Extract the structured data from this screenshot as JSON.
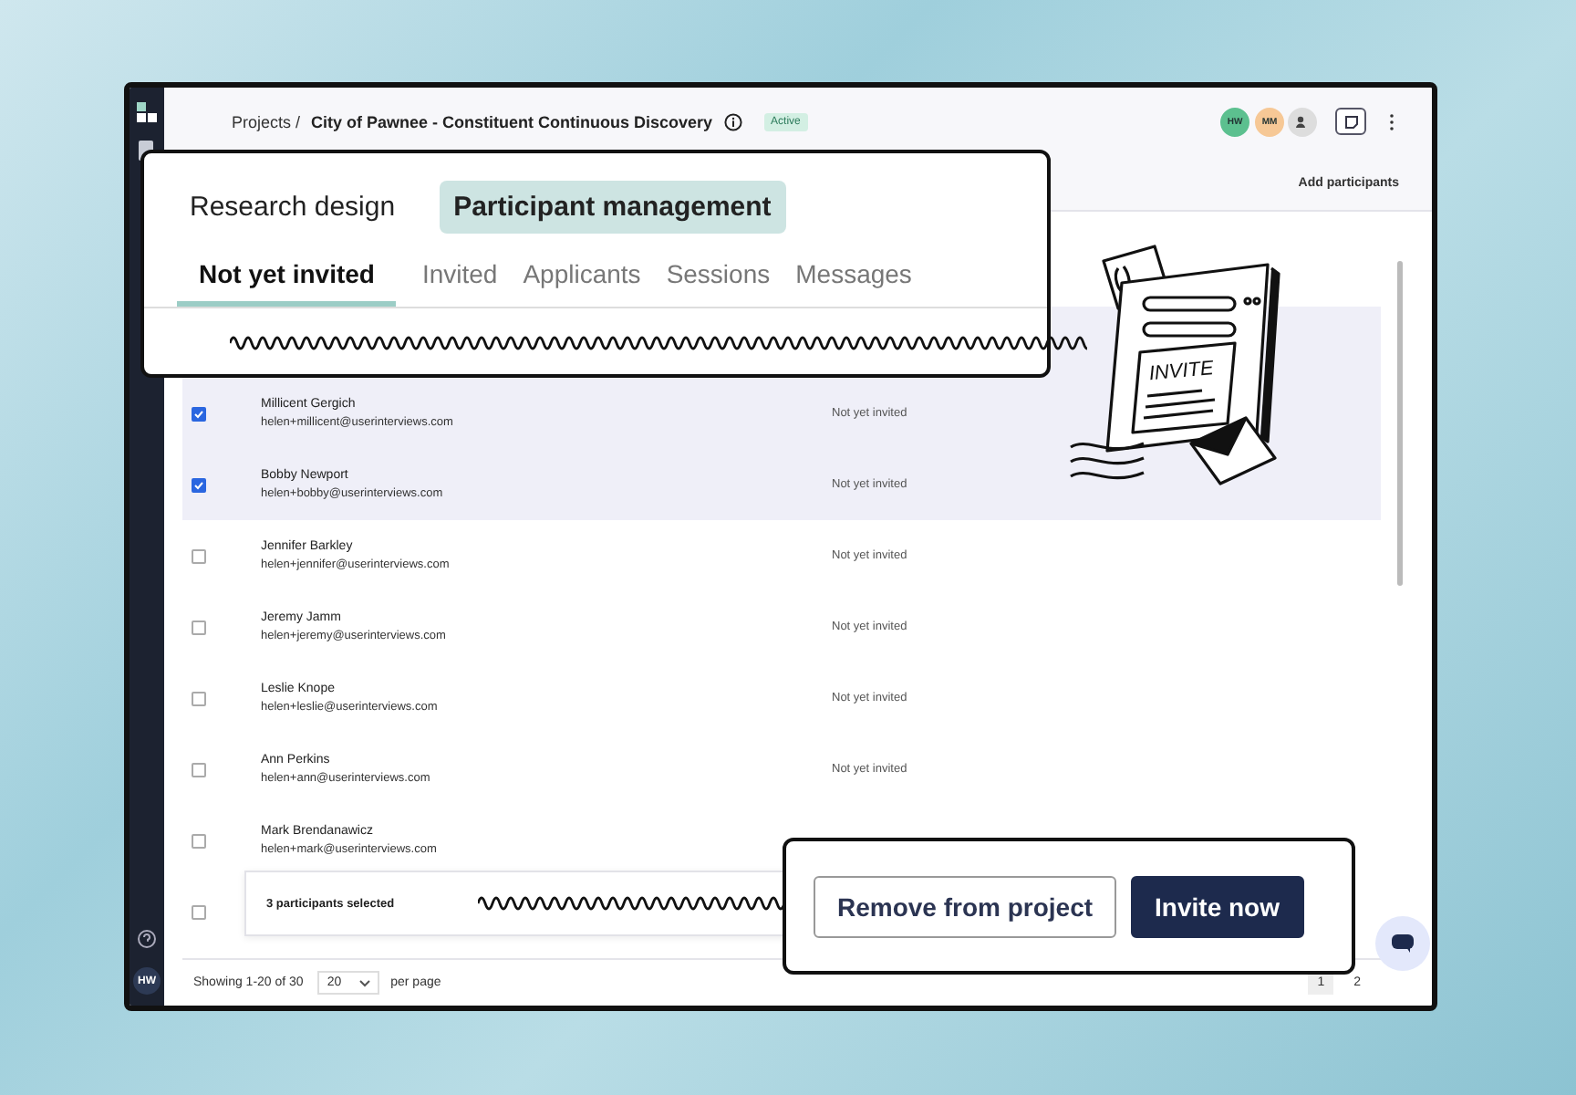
{
  "sidebar": {
    "avatar": "HW"
  },
  "breadcrumb": {
    "parent": "Projects /",
    "title": "City of Pawnee - Constituent Continuous Discovery",
    "status": "Active"
  },
  "collaborators": [
    {
      "initials": "HW",
      "color": "#5cc08f"
    },
    {
      "initials": "MM",
      "color": "#f6c896"
    }
  ],
  "toolbar": {
    "action": "Add participants"
  },
  "main_tabs": [
    {
      "label": "Research design",
      "selected": false
    },
    {
      "label": "Participant management",
      "selected": true
    }
  ],
  "sub_tabs": [
    {
      "label": "Not yet invited",
      "selected": true
    },
    {
      "label": "Invited",
      "selected": false
    },
    {
      "label": "Applicants",
      "selected": false
    },
    {
      "label": "Sessions",
      "selected": false
    },
    {
      "label": "Messages",
      "selected": false
    }
  ],
  "participants": [
    {
      "selected": true
    },
    {
      "name": "Millicent Gergich",
      "email": "helen+millicent@userinterviews.com",
      "status": "Not yet invited",
      "selected": true
    },
    {
      "name": "Bobby Newport",
      "email": "helen+bobby@userinterviews.com",
      "status": "Not yet invited",
      "selected": true
    },
    {
      "name": "Jennifer Barkley",
      "email": "helen+jennifer@userinterviews.com",
      "status": "Not yet invited",
      "selected": false
    },
    {
      "name": "Jeremy Jamm",
      "email": "helen+jeremy@userinterviews.com",
      "status": "Not yet invited",
      "selected": false
    },
    {
      "name": "Leslie Knope",
      "email": "helen+leslie@userinterviews.com",
      "status": "Not yet invited",
      "selected": false
    },
    {
      "name": "Ann Perkins",
      "email": "helen+ann@userinterviews.com",
      "status": "Not yet invited",
      "selected": false
    },
    {
      "name": "Mark Brendanawicz",
      "email": "helen+mark@userinterviews.com",
      "selected": false
    },
    {
      "selected": false
    }
  ],
  "selection_bar": {
    "count": "3 participants selected"
  },
  "actions": [
    {
      "label": "Remove from project",
      "kind": "secondary"
    },
    {
      "label": "Invite now",
      "kind": "primary"
    }
  ],
  "pagination": {
    "summary": "Showing 1-20 of 30",
    "page_size": "20",
    "page_size_label": "per page",
    "pages": [
      {
        "label": "1",
        "selected": true
      },
      {
        "label": "2",
        "selected": false
      }
    ]
  },
  "illustration": {
    "label": "INVITE"
  }
}
